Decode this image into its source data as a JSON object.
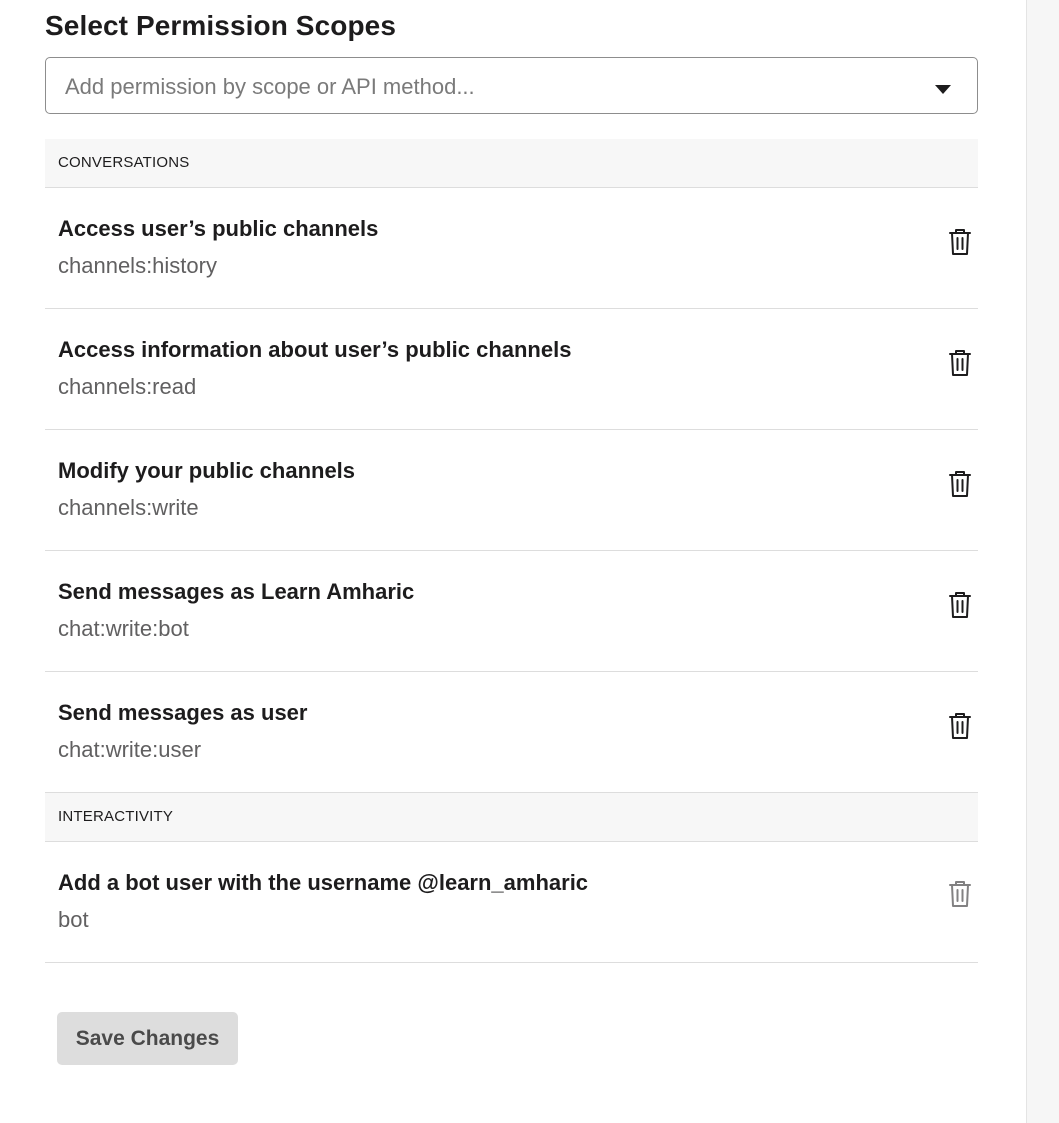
{
  "heading": "Select Permission Scopes",
  "search": {
    "placeholder": "Add permission by scope or API method..."
  },
  "sections": [
    {
      "label": "CONVERSATIONS",
      "scopes": [
        {
          "title": "Access user’s public channels",
          "scope": "channels:history",
          "icon": "trash-icon",
          "removable": true
        },
        {
          "title": "Access information about user’s public channels",
          "scope": "channels:read",
          "icon": "trash-icon",
          "removable": true
        },
        {
          "title": "Modify your public channels",
          "scope": "channels:write",
          "icon": "trash-icon",
          "removable": true
        },
        {
          "title": "Send messages as Learn Amharic",
          "scope": "chat:write:bot",
          "icon": "trash-icon",
          "removable": true
        },
        {
          "title": "Send messages as user",
          "scope": "chat:write:user",
          "icon": "trash-icon",
          "removable": true
        }
      ]
    },
    {
      "label": "INTERACTIVITY",
      "scopes": [
        {
          "title": "Add a bot user with the username @learn_amharic",
          "scope": "bot",
          "icon": "trash-icon",
          "removable": false
        }
      ]
    }
  ],
  "actions": {
    "save_label": "Save Changes"
  },
  "colors": {
    "text_primary": "#1d1c1d",
    "text_secondary": "#616061",
    "section_bg": "#f7f7f7",
    "button_disabled_bg": "#dddddd"
  }
}
